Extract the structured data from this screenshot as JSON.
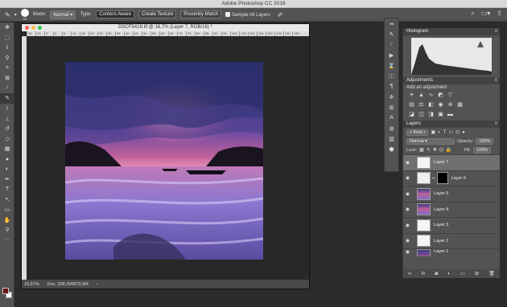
{
  "app": {
    "title": "Adobe Photoshop CC 2018"
  },
  "options": {
    "brush_size": "40",
    "mode_label": "Mode:",
    "mode_value": "Normal",
    "type_label": "Type:",
    "type_content_aware": "Content-Aware",
    "type_create_texture": "Create Texture",
    "type_proximity_match": "Proximity Match",
    "sample_all_layers": "Sample All Layers"
  },
  "document": {
    "title": "DSCF5418.tif @ 16,7% (Layer 7, RGB/16) *",
    "ruler_ticks": [
      "15",
      "10",
      "5",
      "0",
      "5",
      "10",
      "15",
      "20",
      "25",
      "30",
      "35",
      "40",
      "45",
      "50",
      "55",
      "60",
      "65",
      "70",
      "75",
      "80",
      "85",
      "90",
      "95",
      "100",
      "105",
      "110",
      "115",
      "120",
      "125",
      "130",
      "135"
    ],
    "zoom": "16,67%",
    "doc_size": "Doc: 208,2M/870,9M"
  },
  "panels": {
    "histogram": {
      "title": "Histogram"
    },
    "adjustments": {
      "title": "Adjustments",
      "subtitle": "Add an adjustment"
    },
    "layers": {
      "title": "Layers",
      "kind_label": "Kind",
      "blend_mode": "Normal",
      "opacity_label": "Opacity:",
      "opacity_value": "100%",
      "lock_label": "Lock:",
      "fill_label": "Fill:",
      "fill_value": "100%",
      "items": [
        {
          "name": "Layer 7"
        },
        {
          "name": "Layer 6"
        },
        {
          "name": "Layer 5"
        },
        {
          "name": "Layer 4"
        },
        {
          "name": "Layer 3"
        },
        {
          "name": "Layer 2"
        },
        {
          "name": "Layer 1"
        }
      ]
    }
  },
  "colors": {
    "foreground": "#6b1010",
    "background": "#ffffff",
    "accent": "#535353"
  }
}
